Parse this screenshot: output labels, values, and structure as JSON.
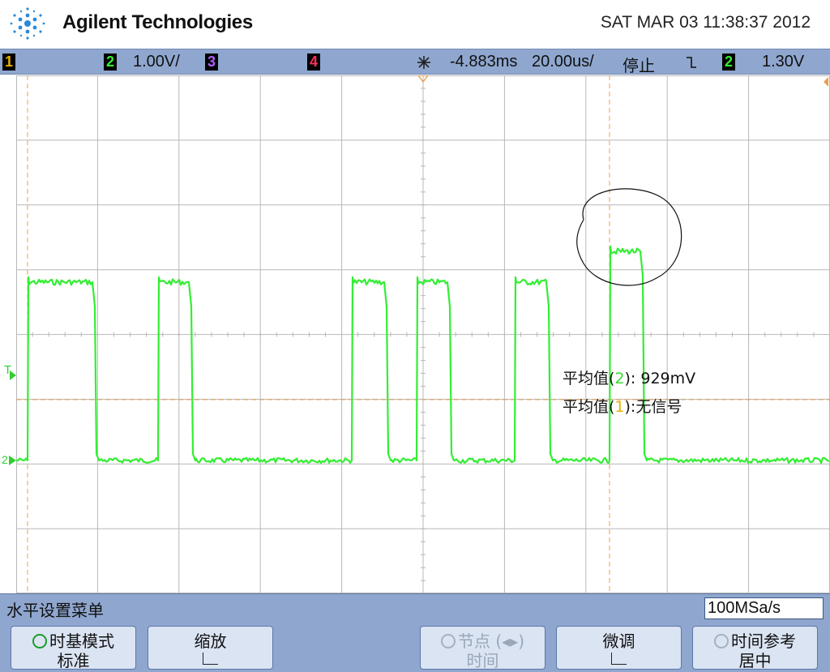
{
  "header": {
    "brand": "Agilent Technologies",
    "datetime": "SAT MAR 03 11:38:37 2012"
  },
  "status_bar": {
    "ch1": "1",
    "ch2": "2",
    "ch2_scale": "1.00V/",
    "ch3": "3",
    "ch4": "4",
    "time_delay": "-4.883ms",
    "time_scale": "20.00us/",
    "run_state": "停止",
    "trigger_icon": "trigger-edge-fall",
    "trigger_source": "2",
    "trigger_level": "1.30V"
  },
  "measurements": {
    "line1_prefix": "平均值(",
    "line1_ch": "2",
    "line1_suffix": "): 929mV",
    "line2_prefix": "平均值(",
    "line2_ch": "1",
    "line2_suffix": "):无信号"
  },
  "markers": {
    "trigger_marker": "T",
    "ch2_marker": "2"
  },
  "menu": {
    "title": "水平设置菜单",
    "sample_rate": "100MSa/s",
    "softkeys": [
      {
        "line1": "时基模式",
        "line2": "标准"
      },
      {
        "line1": "缩放",
        "line2": ""
      },
      {
        "line1": "节点 (◂▸)",
        "line2": "时间"
      },
      {
        "line1": "微调",
        "line2": ""
      },
      {
        "line1": "时间参考",
        "line2": "居中"
      }
    ]
  },
  "colors": {
    "ch1": "#e7b000",
    "ch2": "#33ee33",
    "ch3": "#a040e0",
    "ch4": "#ff3060",
    "grid": "#b8b8b8",
    "cursor": "#e8a050",
    "statusbar": "#8fa7cf"
  }
}
